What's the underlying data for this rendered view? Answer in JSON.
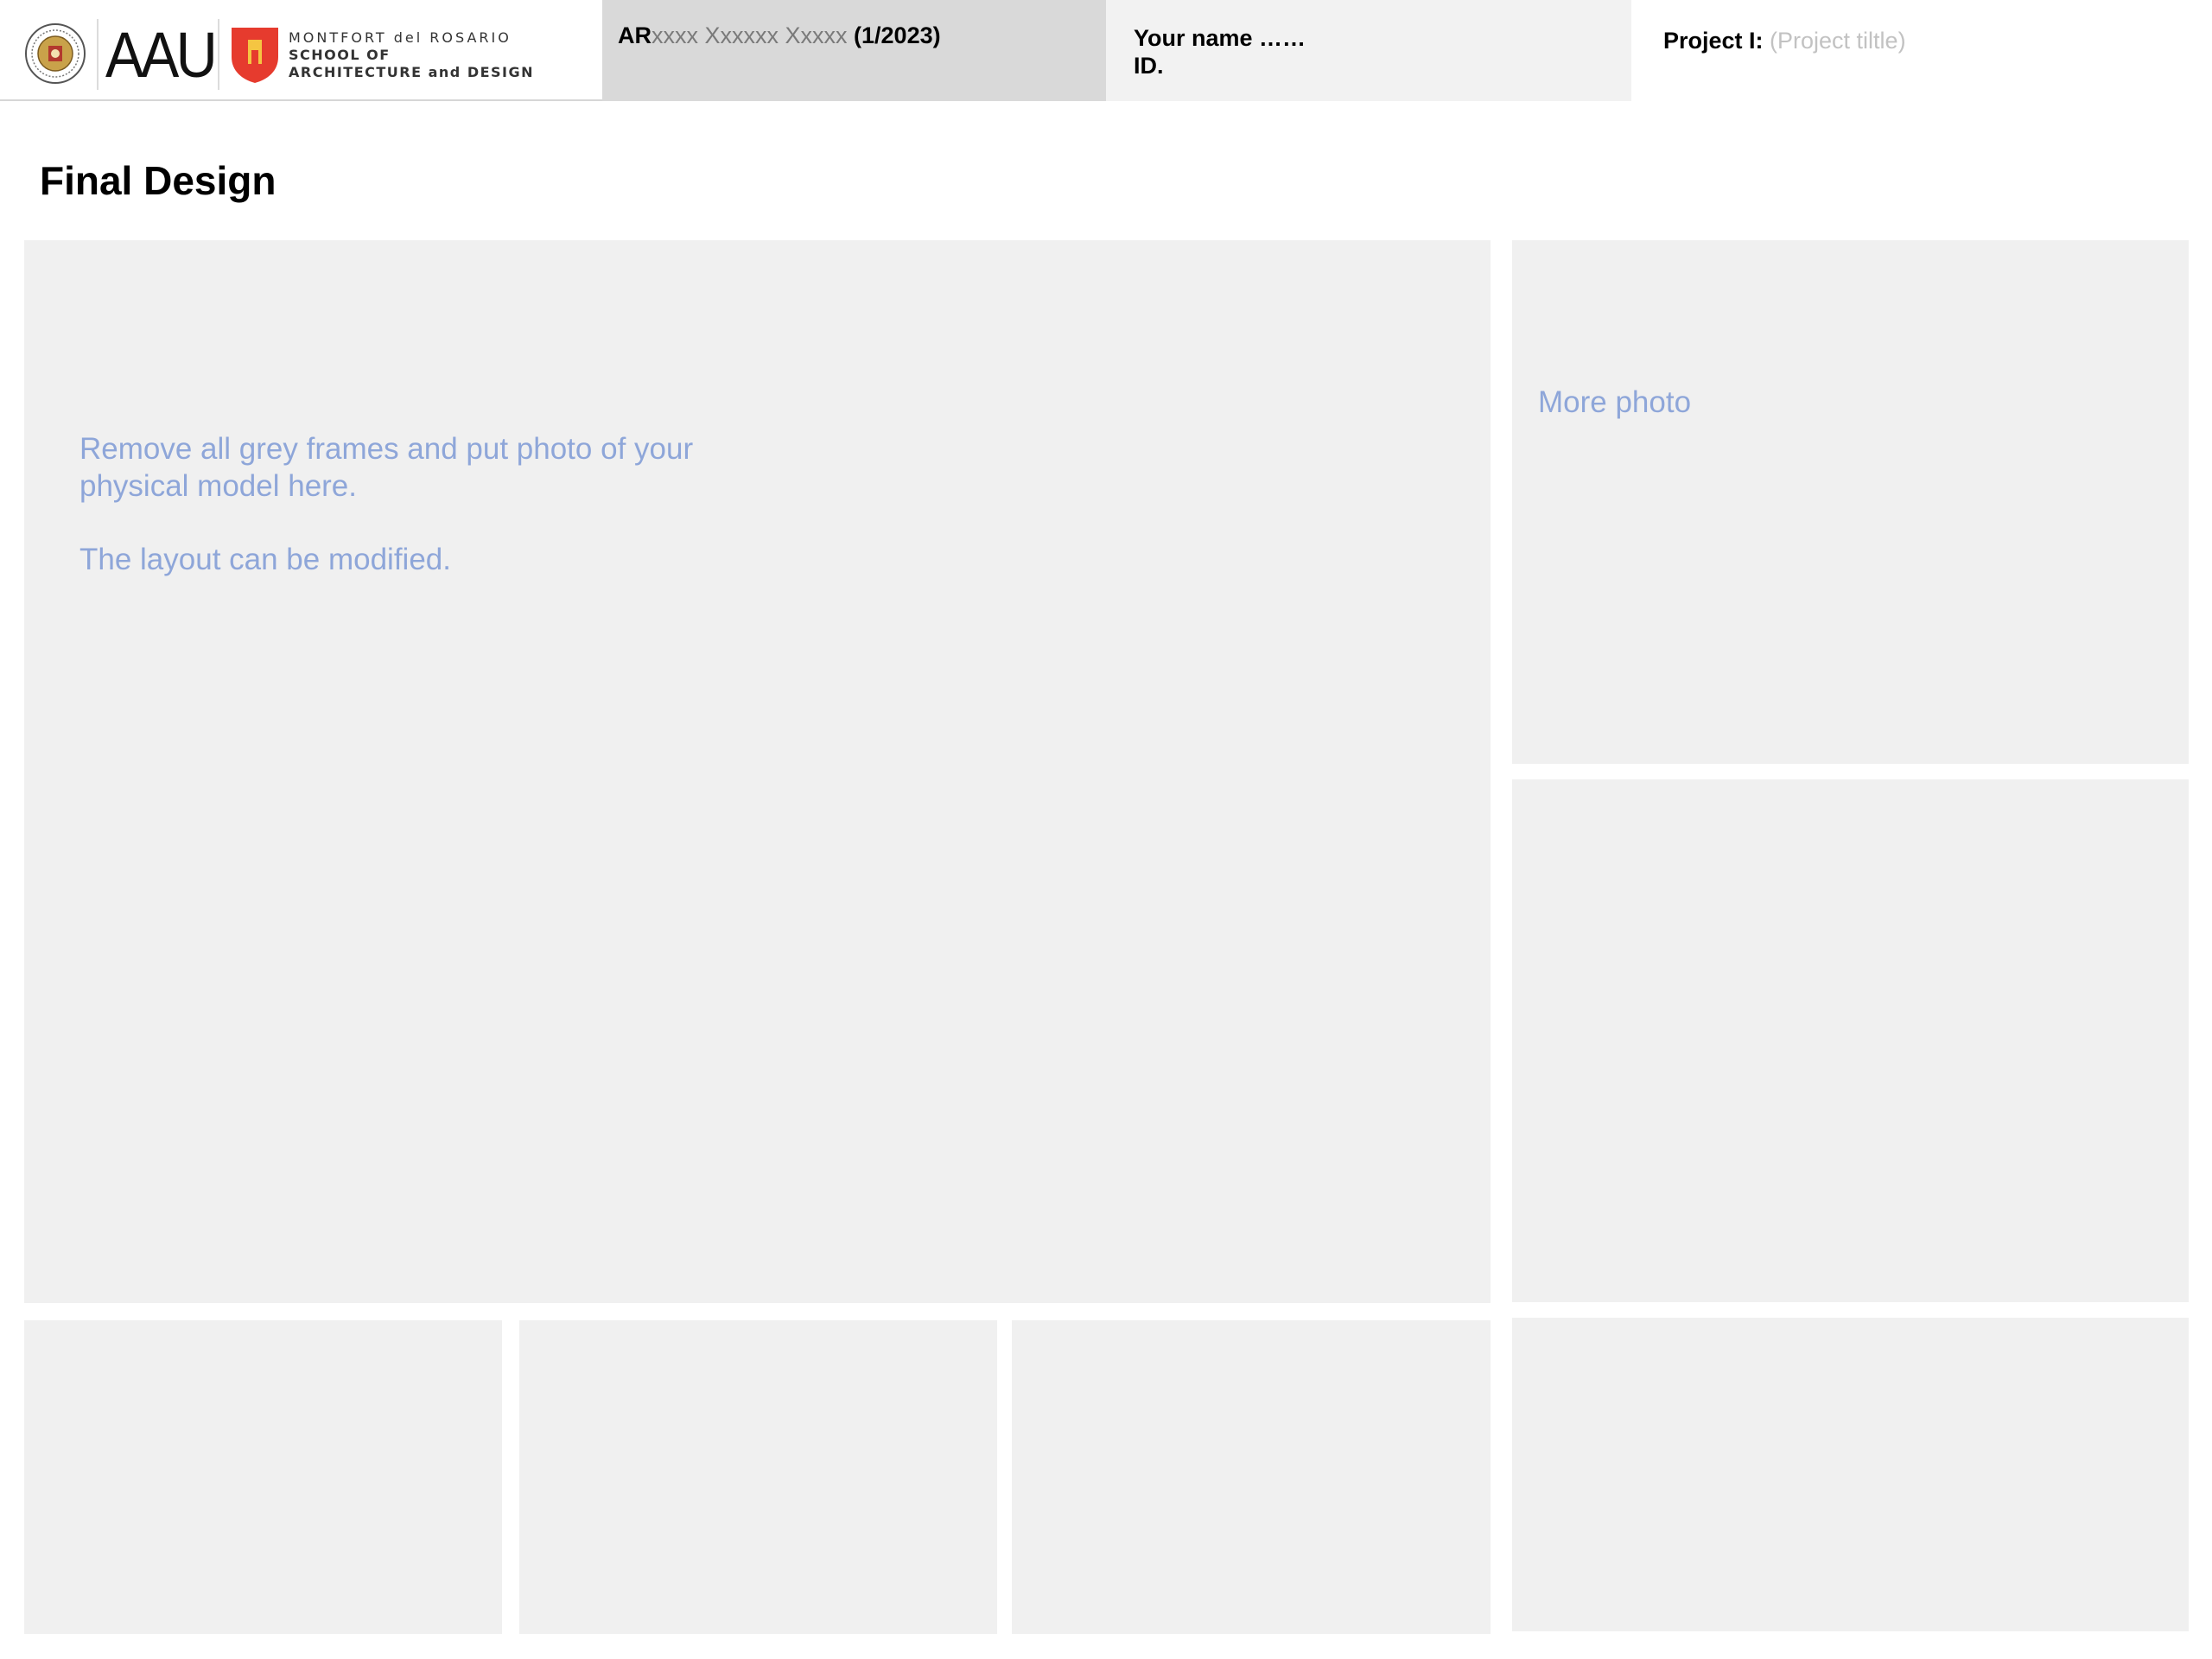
{
  "header": {
    "university_logo_text": "AAU",
    "school_line1": "MONTFORT del ROSARIO",
    "school_line2": "SCHOOL OF",
    "school_line3": "ARCHITECTURE and DESIGN",
    "course_prefix": "AR",
    "course_placeholder": "xxxx Xxxxxx Xxxxx",
    "course_term": " (1/2023)",
    "name_label": "Your name ……",
    "id_label": "ID.",
    "project_label": "Project I: ",
    "project_title_placeholder": "(Project tiltle)"
  },
  "page": {
    "title": "Final Design"
  },
  "main_frame": {
    "instruction_line1": "Remove all grey frames and put photo of your",
    "instruction_line2": "physical model here.",
    "instruction_note": "The layout can be modified."
  },
  "side_frames": {
    "more_photo_label": "More photo"
  },
  "colors": {
    "frame_fill": "#f0f0f0",
    "hint_text": "#8ea6d9",
    "course_cell_bg": "#d9d9d9",
    "name_cell_bg": "#f2f2f2",
    "shield_red": "#e63b2e"
  }
}
